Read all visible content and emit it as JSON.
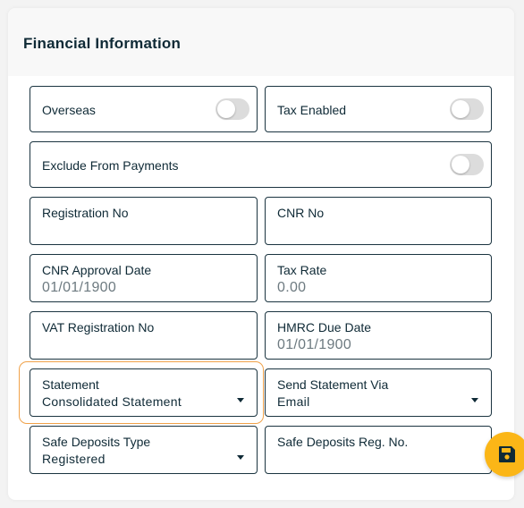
{
  "section": {
    "title": "Financial Information"
  },
  "toggles": {
    "overseas": {
      "label": "Overseas",
      "on": false
    },
    "tax_enabled": {
      "label": "Tax Enabled",
      "on": false
    },
    "exclude_from_payments": {
      "label": "Exclude From Payments",
      "on": false
    }
  },
  "fields": {
    "registration_no": {
      "label": "Registration No",
      "value": ""
    },
    "cnr_no": {
      "label": "CNR No",
      "value": ""
    },
    "cnr_approval_date": {
      "label": "CNR Approval Date",
      "value": "01/01/1900"
    },
    "tax_rate": {
      "label": "Tax Rate",
      "value": "0.00"
    },
    "vat_registration_no": {
      "label": "VAT Registration No",
      "value": ""
    },
    "hmrc_due_date": {
      "label": "HMRC Due Date",
      "value": "01/01/1900"
    },
    "statement": {
      "label": "Statement",
      "value": "Consolidated Statement"
    },
    "send_statement_via": {
      "label": "Send Statement Via",
      "value": "Email"
    },
    "safe_deposits_type": {
      "label": "Safe Deposits Type",
      "value": "Registered"
    },
    "safe_deposits_reg_no": {
      "label": "Safe Deposits Reg. No.",
      "value": ""
    }
  },
  "colors": {
    "accent": "#fbb617",
    "focus_outline": "#f0a24a",
    "border": "#1b3440",
    "text": "#0f2a36",
    "toggle_off": "#dcdcdc"
  },
  "icons": {
    "save": "floppy-disk-icon",
    "dropdown": "caret-down-icon"
  }
}
